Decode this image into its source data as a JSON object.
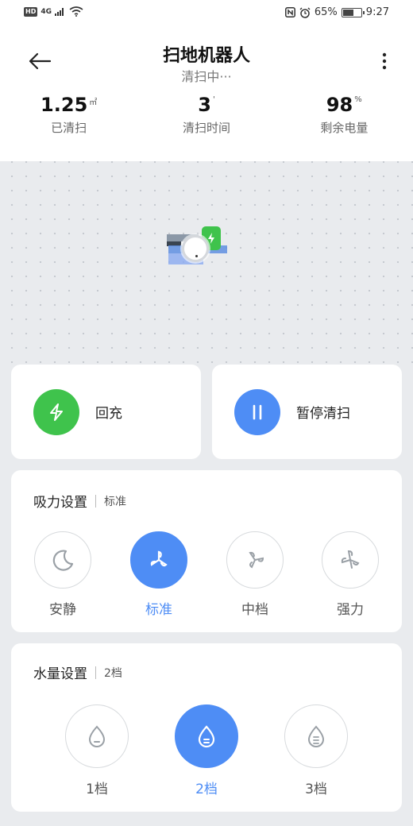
{
  "status_bar": {
    "hd": "HD",
    "network": "4G",
    "battery": "65%",
    "battery_level": 0.65,
    "time": "9:27"
  },
  "header": {
    "title": "扫地机器人",
    "subtitle": "清扫中···"
  },
  "stats": [
    {
      "value": "1.25",
      "unit": "㎡",
      "label": "已清扫"
    },
    {
      "value": "3",
      "unit": "'",
      "label": "清扫时间"
    },
    {
      "value": "98",
      "unit": "%",
      "label": "剩余电量"
    }
  ],
  "actions": {
    "recharge": {
      "label": "回充",
      "color": "#3fc34c"
    },
    "pause": {
      "label": "暂停清扫",
      "color": "#4e8df5"
    }
  },
  "suction": {
    "title": "吸力设置",
    "current": "标准",
    "options": [
      "安静",
      "标准",
      "中档",
      "强力"
    ],
    "selected": 1
  },
  "water": {
    "title": "水量设置",
    "current": "2档",
    "options": [
      "1档",
      "2档",
      "3档"
    ],
    "selected": 1
  },
  "icons": {
    "back": "back-arrow-icon",
    "more": "more-vertical-icon",
    "recharge": "lightning-icon",
    "pause": "pause-icon",
    "suction": [
      "moon-icon",
      "fan-icon",
      "fan-icon",
      "fan-icon"
    ],
    "water": [
      "drop-low-icon",
      "drop-mid-icon",
      "drop-high-icon"
    ]
  },
  "accent_color": "#4e8df5"
}
